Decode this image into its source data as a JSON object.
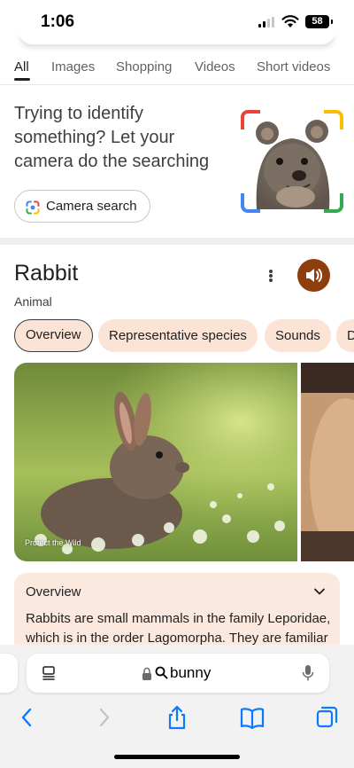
{
  "status": {
    "time": "1:06",
    "battery": "58"
  },
  "tabs": [
    "All",
    "Images",
    "Shopping",
    "Videos",
    "Short videos"
  ],
  "promo": {
    "text": "Trying to identify something? Let your camera do the searching",
    "button_label": "Camera search"
  },
  "knowledge_panel": {
    "title": "Rabbit",
    "subtitle": "Animal",
    "chips": [
      "Overview",
      "Representative species",
      "Sounds",
      "D"
    ],
    "image_credit": "Protect the Wild",
    "overview": {
      "heading": "Overview",
      "text": "Rabbits are small mammals in the family Leporidae, which is in the order Lagomorpha. They are familiar"
    }
  },
  "address_bar": {
    "query": "bunny"
  },
  "colors": {
    "accent_sound": "#8d3e0c",
    "chip_bg": "#fbe3d6",
    "card_bg": "#fbe9df",
    "safari_blue": "#0a7aff"
  },
  "icons": {
    "tabs_icon": "reader-icon",
    "lock": "lock-icon",
    "search": "search-icon",
    "mic": "mic-icon",
    "back": "chevron-left-icon",
    "forward": "chevron-right-icon",
    "share": "share-icon",
    "bookmarks": "book-icon",
    "tabs": "tabs-icon"
  }
}
